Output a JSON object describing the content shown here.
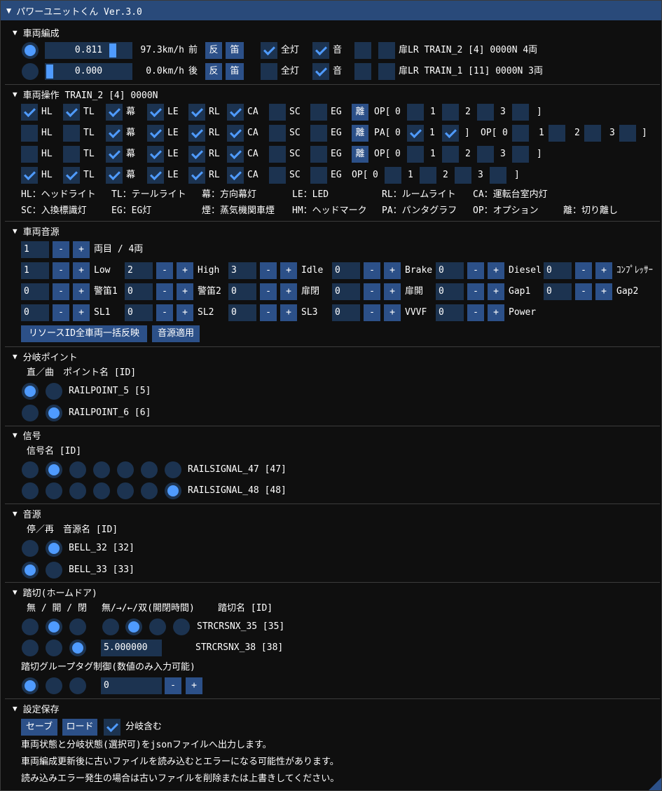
{
  "title": "パワーユニットくん Ver.3.0",
  "sections": {
    "formation": "車両編成",
    "operation": "車両操作 TRAIN_2 [4] 0000N",
    "sound": "車両音源",
    "point": "分岐ポイント",
    "signal": "信号",
    "audio": "音源",
    "crossing": "踏切(ホームドア)",
    "save": "設定保存"
  },
  "formation": [
    {
      "selected": true,
      "throttle_label": "0.811",
      "throttle_fraction": 0.811,
      "speed": "97.3km/h",
      "dir": "前",
      "reverse": "反",
      "whistle": "笛",
      "lights_checked": true,
      "lights": "全灯",
      "sound_checked": true,
      "sound": "音",
      "door_l": false,
      "door_r": false,
      "info": "扉LR TRAIN_2 [4] 0000N 4両"
    },
    {
      "selected": false,
      "throttle_label": "0.000",
      "throttle_fraction": 0.0,
      "speed": "0.0km/h",
      "dir": "後",
      "reverse": "反",
      "whistle": "笛",
      "lights_checked": false,
      "lights": "全灯",
      "sound_checked": true,
      "sound": "音",
      "door_l": false,
      "door_r": false,
      "info": "扉LR TRAIN_1 [11] 0000N 3両"
    }
  ],
  "ops": {
    "flags": [
      "HL",
      "TL",
      "幕",
      "LE",
      "RL",
      "CA",
      "SC",
      "EG"
    ],
    "rows": [
      {
        "checks": [
          true,
          true,
          true,
          true,
          true,
          true,
          false,
          false
        ],
        "detach": "離",
        "group": "OP[",
        "opts": [
          "0",
          "1",
          "2",
          "3"
        ],
        "opt_checks": [
          false,
          false,
          false,
          false
        ],
        "close": "]"
      },
      {
        "checks": [
          false,
          false,
          true,
          true,
          true,
          true,
          false,
          false
        ],
        "detach": "離",
        "group": "PA[",
        "pa_opts": [
          "0",
          "1"
        ],
        "pa_checks": [
          true,
          true
        ],
        "pa_close": "]",
        "group2": "OP[",
        "opts": [
          "0",
          "1",
          "2",
          "3"
        ],
        "opt_checks": [
          false,
          false,
          false,
          false
        ],
        "close": "]"
      },
      {
        "checks": [
          false,
          false,
          true,
          true,
          true,
          true,
          false,
          false
        ],
        "detach": "離",
        "group": "OP[",
        "opts": [
          "0",
          "1",
          "2",
          "3"
        ],
        "opt_checks": [
          false,
          false,
          false,
          false
        ],
        "close": "]"
      },
      {
        "checks": [
          true,
          true,
          true,
          true,
          true,
          true,
          false,
          false
        ],
        "group": "OP[",
        "opts": [
          "0",
          "1",
          "2",
          "3"
        ],
        "opt_checks": [
          false,
          false,
          false,
          false
        ],
        "close": "]"
      }
    ],
    "legend1": [
      "HL：ヘッドライト",
      "TL：テールライト",
      "幕：方向幕灯",
      "LE：LED",
      "RL：ルームライト",
      "CA：運転台室内灯"
    ],
    "legend2": [
      "SC：入換標識灯",
      "EG：EG灯",
      "煙：蒸気機関車煙",
      "HM：ヘッドマーク",
      "PA：パンタグラフ",
      "OP：オプション",
      "離：切り離し"
    ]
  },
  "sound": {
    "car_value": "1",
    "car_label": "両目 / 4両",
    "minus": "-",
    "plus": "+",
    "rows": [
      [
        {
          "v": "1",
          "l": "Low"
        },
        {
          "v": "2",
          "l": "High"
        },
        {
          "v": "3",
          "l": "Idle"
        },
        {
          "v": "0",
          "l": "Brake"
        },
        {
          "v": "0",
          "l": "Diesel"
        },
        {
          "v": "0",
          "l": "ｺﾝﾌﾟﾚｯｻｰ"
        }
      ],
      [
        {
          "v": "0",
          "l": "警笛1"
        },
        {
          "v": "0",
          "l": "警笛2"
        },
        {
          "v": "0",
          "l": "扉閉"
        },
        {
          "v": "0",
          "l": "扉開"
        },
        {
          "v": "0",
          "l": "Gap1"
        },
        {
          "v": "0",
          "l": "Gap2"
        }
      ],
      [
        {
          "v": "0",
          "l": "SL1"
        },
        {
          "v": "0",
          "l": "SL2"
        },
        {
          "v": "0",
          "l": "SL3"
        },
        {
          "v": "0",
          "l": "VVVF"
        },
        {
          "v": "0",
          "l": "Power"
        }
      ]
    ],
    "apply_all": "リソースID全車両一括反映",
    "apply": "音源適用"
  },
  "points": {
    "header": "直／曲　ポイント名 [ID]",
    "rows": [
      {
        "sel": [
          true,
          false
        ],
        "name": "RAILPOINT_5 [5]"
      },
      {
        "sel": [
          false,
          true
        ],
        "name": "RAILPOINT_6 [6]"
      }
    ]
  },
  "signals": {
    "header": "信号名 [ID]",
    "rows": [
      {
        "sel": [
          false,
          true,
          false,
          false,
          false,
          false,
          false
        ],
        "name": "RAILSIGNAL_47 [47]"
      },
      {
        "sel": [
          false,
          false,
          false,
          false,
          false,
          false,
          true
        ],
        "name": "RAILSIGNAL_48 [48]"
      }
    ]
  },
  "audio": {
    "header": "停／再　音源名 [ID]",
    "rows": [
      {
        "sel": [
          false,
          true
        ],
        "name": "BELL_32 [32]"
      },
      {
        "sel": [
          true,
          false
        ],
        "name": "BELL_33 [33]"
      }
    ]
  },
  "crossings": {
    "header1": "無 / 開 / 閉",
    "header2": "無/→/←/双(開閉時間)",
    "header3": "踏切名 [ID]",
    "rows": [
      {
        "sel": [
          false,
          true,
          false
        ],
        "mode": [
          false,
          true,
          false,
          false
        ],
        "name": "STRCRSNX_35 [35]"
      },
      {
        "sel": [
          false,
          false,
          true
        ],
        "time": "5.000000",
        "name": "STRCRSNX_38 [38]"
      }
    ],
    "group_label": "踏切グループタグ制御(数値のみ入力可能)",
    "group_sel": [
      true,
      false,
      false
    ],
    "group_value": "0"
  },
  "save": {
    "save_btn": "セーブ",
    "load_btn": "ロード",
    "include_checked": true,
    "include_label": "分岐含む",
    "notes": [
      "車両状態と分岐状態(選択可)をjsonファイルへ出力します。",
      "車両編成更新後に古いファイルを読み込むとエラーになる可能性があります。",
      "読み込みエラー発生の場合は古いファイルを削除または上書きしてください。"
    ]
  },
  "colors": {
    "accent": "#4f9bff",
    "title_bar": "#294a7a",
    "frame": "#1c3350",
    "button": "#2c5088",
    "background": "#0f0f0f"
  }
}
